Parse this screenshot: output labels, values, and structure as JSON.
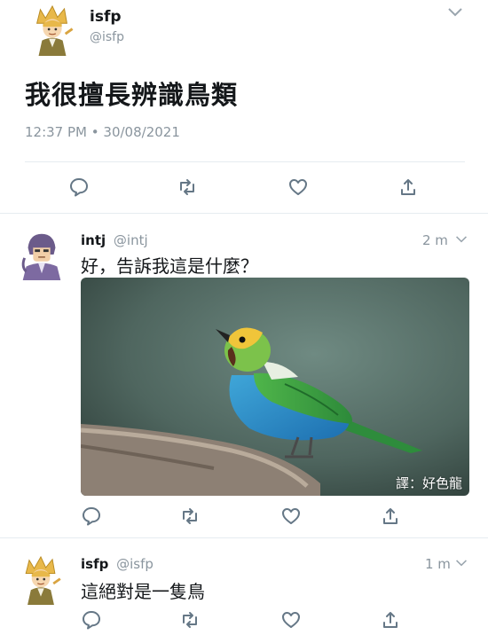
{
  "tweet_main": {
    "name": "isfp",
    "handle": "@isfp",
    "text": "我很擅長辨識鳥類",
    "time": "12:37 PM",
    "sep": "•",
    "date": "30/08/2021",
    "icons": [
      "reply-icon",
      "retweet-icon",
      "like-icon",
      "share-icon"
    ]
  },
  "reply_1": {
    "name": "intj",
    "handle": "@intj",
    "age": "2 m",
    "text": "好，告訴我這是什麼？",
    "image_watermark": "譯：好色龍",
    "image_alt_icon": "bird-photo"
  },
  "reply_2": {
    "name": "isfp",
    "handle": "@isfp",
    "age": "1 m",
    "text": "這絕對是一隻鳥"
  },
  "colors": {
    "divider": "#e6ecf0",
    "icon": "#657786",
    "handle": "#8a959e"
  }
}
